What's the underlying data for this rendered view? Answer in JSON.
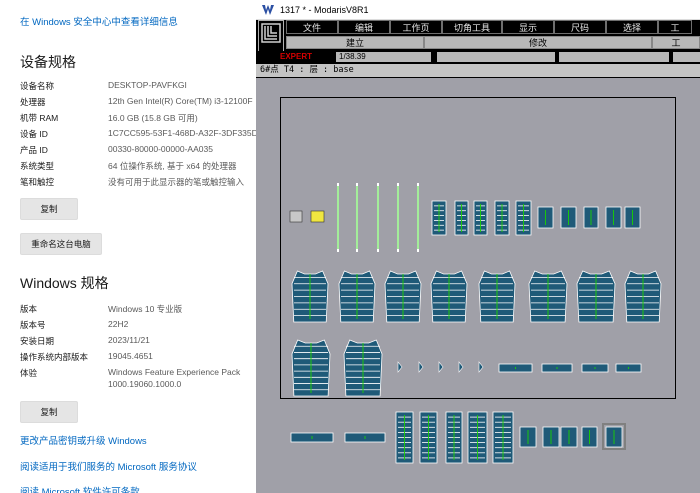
{
  "settings": {
    "security_link": "在 Windows 安全中心中查看详细信息",
    "device_specs_title": "设备规格",
    "device_specs": [
      {
        "key": "设备名称",
        "value": "DESKTOP-PAVFKGI"
      },
      {
        "key": "处理器",
        "value": "12th Gen Intel(R) Core(TM) i3-12100F"
      },
      {
        "key": "机带 RAM",
        "value": "16.0 GB (15.8 GB 可用)"
      },
      {
        "key": "设备 ID",
        "value": "1C7CC595-53F1-468D-A32F-3DF335D"
      },
      {
        "key": "产品 ID",
        "value": "00330-80000-00000-AA035"
      },
      {
        "key": "系统类型",
        "value": "64 位操作系统, 基于 x64 的处理器"
      },
      {
        "key": "笔和触控",
        "value": "没有可用于此显示器的笔或触控输入"
      }
    ],
    "copy_button_1": "复制",
    "rename_button": "重命名这台电脑",
    "windows_specs_title": "Windows 规格",
    "windows_specs": [
      {
        "key": "版本",
        "value": "Windows 10 专业版"
      },
      {
        "key": "版本号",
        "value": "22H2"
      },
      {
        "key": "安装日期",
        "value": "2023/11/21"
      },
      {
        "key": "操作系统内部版本",
        "value": "19045.4651"
      },
      {
        "key": "体验",
        "value": "Windows Feature Experience Pack"
      },
      {
        "key": "",
        "value": "1000.19060.1000.0"
      }
    ],
    "copy_button_2": "复制",
    "links": [
      "更改产品密钥或升级 Windows",
      "阅读适用于我们服务的 Microsoft 服务协议",
      "阅读 Microsoft 软件许可条款"
    ]
  },
  "modaris": {
    "title": "1317 *  - ModarisV8R1",
    "menu": [
      "文件",
      "编辑",
      "工作页",
      "切角工具",
      "显示",
      "尺码",
      "选择",
      "工"
    ],
    "subbar": [
      "建立",
      "修改",
      "工"
    ],
    "expert_label": "EXPERT",
    "scale_value": "1/38.39",
    "info_line": "6#点  T4  :    层 :  base",
    "colors": {
      "piece_fill": "#1f5a78",
      "piece_stripe": "#ffffff",
      "grain": "#19d200",
      "canvas": "#a0a0a8"
    }
  }
}
